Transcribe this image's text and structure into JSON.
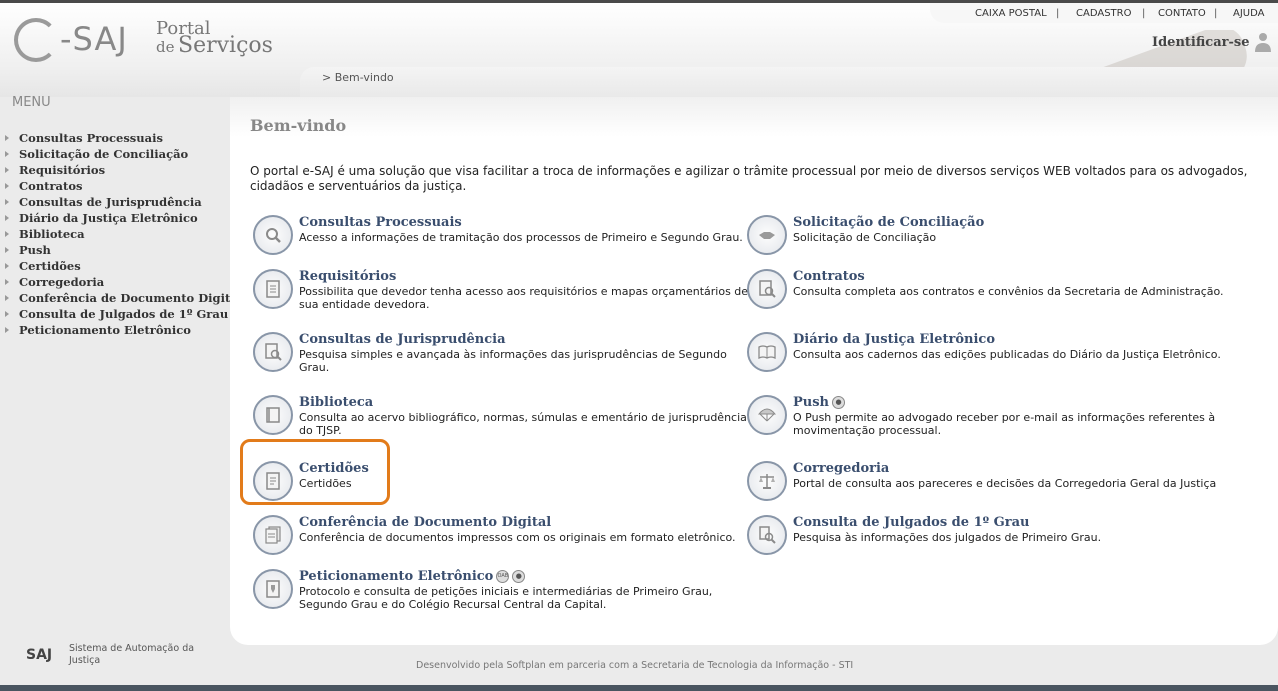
{
  "header": {
    "logo": {
      "e": "e",
      "saj": "-SAJ",
      "portal": "Portal",
      "de": "de",
      "servicos": "Serviços"
    },
    "topnav": [
      "CAIXA POSTAL",
      "CADASTRO",
      "CONTATO",
      "AJUDA"
    ],
    "topnav_sep": "|",
    "identify": "Identificar-se",
    "breadcrumb": "> Bem-vindo"
  },
  "menu": {
    "title": "MENU",
    "items": [
      "Consultas Processuais",
      "Solicitação de Conciliação",
      "Requisitórios",
      "Contratos",
      "Consultas de Jurisprudência",
      "Diário da Justiça Eletrônico",
      "Biblioteca",
      "Push",
      "Certidões",
      "Corregedoria",
      "Conferência de Documento Digital",
      "Consulta de Julgados de 1º Grau",
      "Peticionamento Eletrônico"
    ]
  },
  "main": {
    "title": "Bem-vindo",
    "intro": "O portal e-SAJ é uma solução que visa facilitar a troca de informações e agilizar o trâmite processual por meio de diversos serviços WEB voltados para os advogados, cidadãos e serventuários da justiça.",
    "services": [
      {
        "title": "Consultas Processuais",
        "desc": "Acesso a informações de tramitação dos processos de Primeiro e Segundo Grau.",
        "icon": "magnifier-icon"
      },
      {
        "title": "Solicitação de Conciliação",
        "desc": "Solicitação de Conciliação",
        "icon": "handshake-icon"
      },
      {
        "title": "Requisitórios",
        "desc": "Possibilita que devedor tenha acesso aos requisitórios e mapas orçamentários de sua entidade devedora.",
        "icon": "document-icon"
      },
      {
        "title": "Contratos",
        "desc": "Consulta completa aos contratos e convênios da Secretaria de Administração.",
        "icon": "contract-search-icon"
      },
      {
        "title": "Consultas de Jurisprudência",
        "desc": "Pesquisa simples e avançada às informações das jurisprudências de Segundo Grau.",
        "icon": "document-search-icon"
      },
      {
        "title": "Diário da Justiça Eletrônico",
        "desc": "Consulta aos cadernos das edições publicadas do Diário da Justiça Eletrônico.",
        "icon": "open-book-icon"
      },
      {
        "title": "Biblioteca",
        "desc": "Consulta ao acervo bibliográfico, normas, súmulas e ementário de jurisprudência do TJSP.",
        "icon": "book-icon"
      },
      {
        "title": "Push",
        "desc": "O Push permite ao advogado receber por e-mail as informações referentes à movimentação processual.",
        "icon": "parachute-icon",
        "badges": [
          "user-badge-icon"
        ]
      },
      {
        "title": "Certidões",
        "desc": "Certidões",
        "icon": "certificate-icon"
      },
      {
        "title": "Corregedoria",
        "desc": "Portal de consulta aos pareceres e decisões da Corregedoria Geral da Justiça",
        "icon": "scales-icon"
      },
      {
        "title": "Conferência de Documento Digital",
        "desc": "Conferência de documentos impressos com os originais em formato eletrônico.",
        "icon": "stacked-documents-icon"
      },
      {
        "title": "Consulta de Julgados de 1º Grau",
        "desc": "Pesquisa às informações dos julgados de Primeiro Grau.",
        "icon": "document-magnifier-icon"
      },
      {
        "title": "Peticionamento Eletrônico",
        "desc": "Protocolo e consulta de petições iniciais e intermediárias de Primeiro Grau, Segundo Grau e do Colégio Recursal Central da Capital.",
        "icon": "petition-icon",
        "badges": [
          "oab-badge-icon",
          "lock-badge-icon"
        ],
        "badge_text": "OAB"
      }
    ]
  },
  "footer": {
    "logo": "SAJ",
    "system": "Sistema de Automação da Justiça",
    "developed": "Desenvolvido pela Softplan em parceria com a Secretaria de Tecnologia da Informação - STI"
  },
  "colors": {
    "service_title": "#3a4e6e",
    "highlight": "#e27b1a",
    "page_title": "#888888"
  }
}
